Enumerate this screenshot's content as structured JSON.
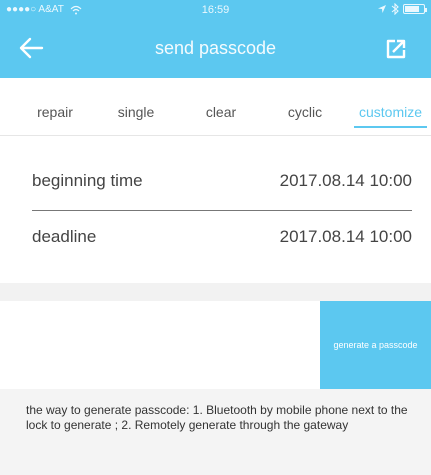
{
  "status_bar": {
    "carrier": "●●●●○ A&AT",
    "time": "16:59",
    "right_icons": [
      "location-icon",
      "bluetooth-icon",
      "battery-icon"
    ],
    "battery_level": 0.8
  },
  "header": {
    "title": "send passcode",
    "back_icon": "arrow-left-icon",
    "action_icon": "export-icon",
    "bg_color": "#5cc8f0"
  },
  "tabs": [
    {
      "label": "repair",
      "active": false
    },
    {
      "label": "single",
      "active": false
    },
    {
      "label": "clear",
      "active": false
    },
    {
      "label": "cyclic",
      "active": false
    },
    {
      "label": "customize",
      "active": true
    }
  ],
  "form": {
    "beginning_label": "beginning time",
    "beginning_value": "2017.08.14 10:00",
    "deadline_label": "deadline",
    "deadline_value": "2017.08.14 10:00"
  },
  "generate_button": {
    "label": "generate a passcode"
  },
  "note": {
    "text": "the way to  generate passcode: 1. Bluetooth by mobile phone next to the lock to generate ; 2. Remotely generate through the gateway"
  }
}
